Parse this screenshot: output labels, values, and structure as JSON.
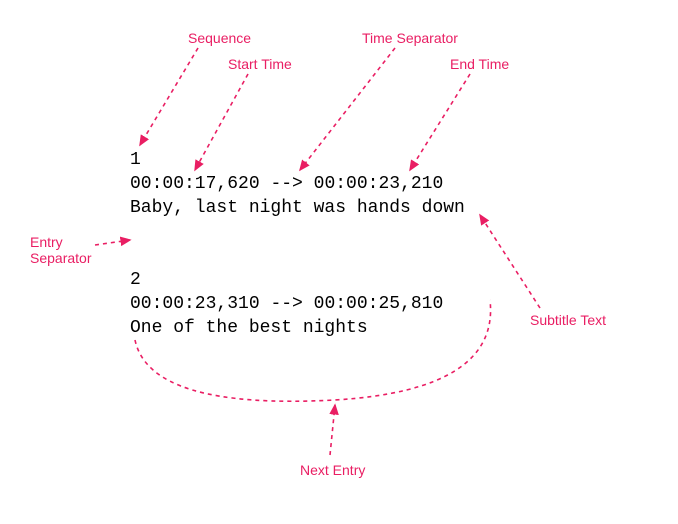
{
  "labels": {
    "sequence": "Sequence",
    "start_time": "Start Time",
    "time_separator": "Time Separator",
    "end_time": "End Time",
    "entry_separator": "Entry\nSeparator",
    "subtitle_text": "Subtitle Text",
    "next_entry": "Next Entry"
  },
  "entries": [
    {
      "sequence": "1",
      "start": "00:00:17,620",
      "separator": "-->",
      "end": "00:00:23,210",
      "text": "Baby, last night was hands down"
    },
    {
      "sequence": "2",
      "start": "00:00:23,310",
      "separator": "-->",
      "end": "00:00:25,810",
      "text": "One of the best nights"
    }
  ],
  "colors": {
    "annotation": "#e91e63"
  }
}
